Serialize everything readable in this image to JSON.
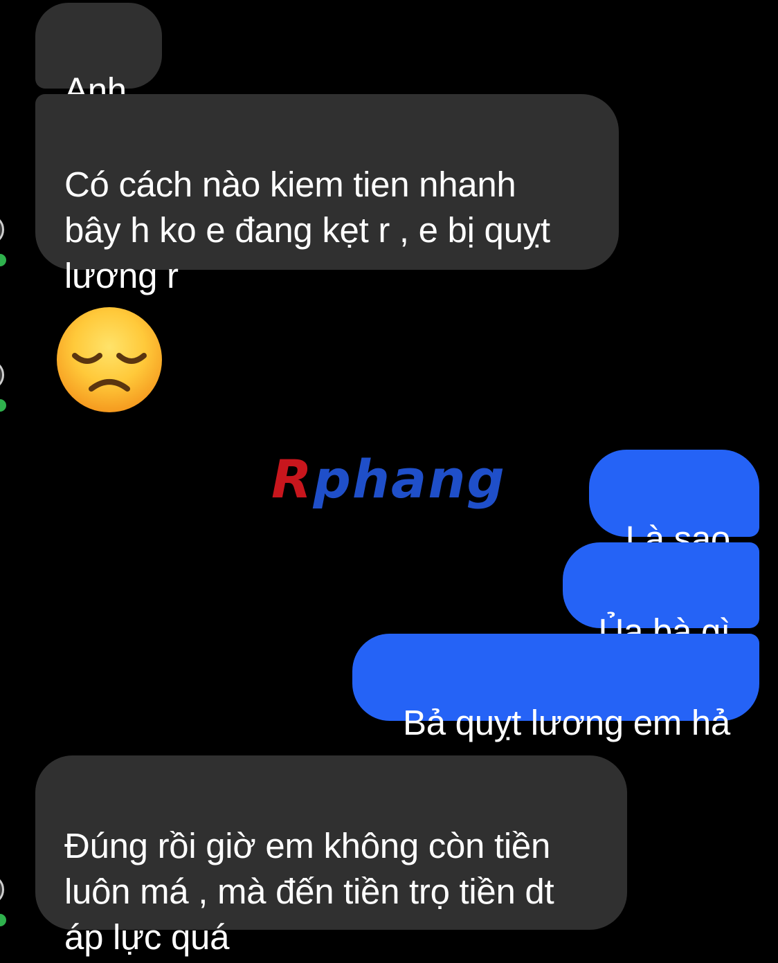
{
  "messages": {
    "in_1": "Anh",
    "in_2": "Có cách nào kiem tien nhanh\nbây h ko e đang kẹt r , e bị quỵt\nlương r",
    "in_3_emoji": "pensive-face-emoji",
    "out_1": "Là sao",
    "out_2": "Ủa bà gì",
    "out_3": "Bả quỵt lương em hả",
    "in_4": "Đúng rồi giờ em không còn tiền\nluôn má , mà đến tiền trọ tiền dt\náp lực quá"
  },
  "watermark": {
    "first": "R",
    "rest": "phang"
  },
  "colors": {
    "background": "#000000",
    "incoming_bubble": "#303030",
    "outgoing_bubble": "#2563f6",
    "online_dot": "#2fb14d"
  }
}
